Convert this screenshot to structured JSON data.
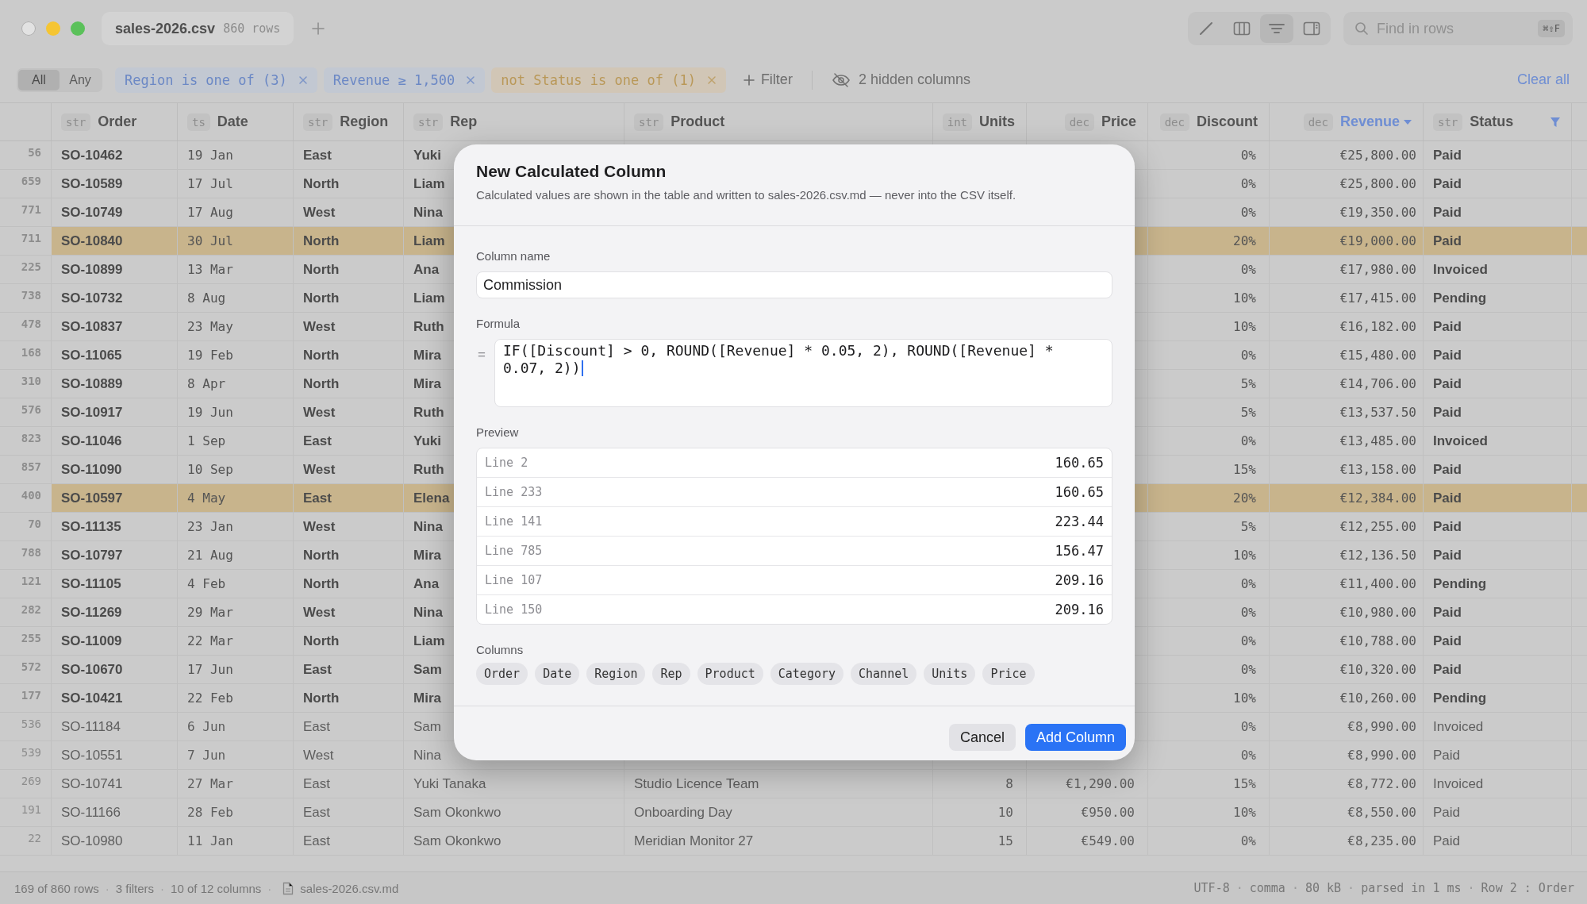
{
  "tab": {
    "title": "sales-2026.csv",
    "meta": "860 rows"
  },
  "toolbar": [
    {
      "kind": "pencil",
      "selected": false
    },
    {
      "kind": "columns",
      "selected": false
    },
    {
      "kind": "lines",
      "selected": true
    },
    {
      "kind": "sidebar",
      "selected": false
    }
  ],
  "search": {
    "placeholder": "Find in rows",
    "shortcut": "⌘⇧F"
  },
  "filter_bar": {
    "match": [
      {
        "label": "All",
        "selected": true
      },
      {
        "label": "Any",
        "selected": false
      }
    ],
    "filters": [
      {
        "label": "Region is one of (3)",
        "kind": "include"
      },
      {
        "label": "Revenue ≥ 1,500",
        "kind": "include"
      },
      {
        "label": "not Status is one of (1)",
        "kind": "exclude"
      }
    ],
    "add_filter": "Filter",
    "hidden_columns": "2 hidden columns",
    "clear": "Clear all"
  },
  "table": {
    "columns": [
      {
        "type": "str",
        "name": "Order",
        "sorted": false,
        "filtered": false
      },
      {
        "type": "ts",
        "name": "Date",
        "sorted": false,
        "filtered": false
      },
      {
        "type": "str",
        "name": "Region",
        "sorted": false,
        "filtered": false
      },
      {
        "type": "str",
        "name": "Rep",
        "sorted": false,
        "filtered": false
      },
      {
        "type": "str",
        "name": "Product",
        "sorted": false,
        "filtered": false
      },
      {
        "type": "int",
        "name": "Units",
        "sorted": false,
        "filtered": false
      },
      {
        "type": "dec",
        "name": "Price",
        "sorted": false,
        "filtered": false
      },
      {
        "type": "dec",
        "name": "Discount",
        "sorted": false,
        "filtered": false
      },
      {
        "type": "dec",
        "name": "Revenue",
        "sorted": true,
        "filtered": false
      },
      {
        "type": "str",
        "name": "Status",
        "sorted": false,
        "filtered": true
      }
    ],
    "rows": [
      {
        "line": "56",
        "order": "SO-10462",
        "date": "19 Jan",
        "region": "East",
        "rep": "Yuki",
        "discount": "0%",
        "revenue": "€25,800.00",
        "status": "Paid",
        "highlighted": false,
        "emphasized": true
      },
      {
        "line": "659",
        "order": "SO-10589",
        "date": "17 Jul",
        "region": "North",
        "rep": "Liam",
        "discount": "0%",
        "revenue": "€25,800.00",
        "status": "Paid",
        "highlighted": false,
        "emphasized": true
      },
      {
        "line": "771",
        "order": "SO-10749",
        "date": "17 Aug",
        "region": "West",
        "rep": "Nina",
        "discount": "0%",
        "revenue": "€19,350.00",
        "status": "Paid",
        "highlighted": false,
        "emphasized": true
      },
      {
        "line": "711",
        "order": "SO-10840",
        "date": "30 Jul",
        "region": "North",
        "rep": "Liam",
        "discount": "20%",
        "revenue": "€19,000.00",
        "status": "Paid",
        "highlighted": true,
        "emphasized": true
      },
      {
        "line": "225",
        "order": "SO-10899",
        "date": "13 Mar",
        "region": "North",
        "rep": "Ana",
        "discount": "0%",
        "revenue": "€17,980.00",
        "status": "Invoiced",
        "highlighted": false,
        "emphasized": true
      },
      {
        "line": "738",
        "order": "SO-10732",
        "date": "8 Aug",
        "region": "North",
        "rep": "Liam",
        "discount": "10%",
        "revenue": "€17,415.00",
        "status": "Pending",
        "highlighted": false,
        "emphasized": true
      },
      {
        "line": "478",
        "order": "SO-10837",
        "date": "23 May",
        "region": "West",
        "rep": "Ruth",
        "discount": "10%",
        "revenue": "€16,182.00",
        "status": "Paid",
        "highlighted": false,
        "emphasized": true
      },
      {
        "line": "168",
        "order": "SO-11065",
        "date": "19 Feb",
        "region": "North",
        "rep": "Mira",
        "discount": "0%",
        "revenue": "€15,480.00",
        "status": "Paid",
        "highlighted": false,
        "emphasized": true
      },
      {
        "line": "310",
        "order": "SO-10889",
        "date": "8 Apr",
        "region": "North",
        "rep": "Mira",
        "discount": "5%",
        "revenue": "€14,706.00",
        "status": "Paid",
        "highlighted": false,
        "emphasized": true
      },
      {
        "line": "576",
        "order": "SO-10917",
        "date": "19 Jun",
        "region": "West",
        "rep": "Ruth",
        "discount": "5%",
        "revenue": "€13,537.50",
        "status": "Paid",
        "highlighted": false,
        "emphasized": true
      },
      {
        "line": "823",
        "order": "SO-11046",
        "date": "1 Sep",
        "region": "East",
        "rep": "Yuki",
        "discount": "0%",
        "revenue": "€13,485.00",
        "status": "Invoiced",
        "highlighted": false,
        "emphasized": true
      },
      {
        "line": "857",
        "order": "SO-11090",
        "date": "10 Sep",
        "region": "West",
        "rep": "Ruth",
        "discount": "15%",
        "revenue": "€13,158.00",
        "status": "Paid",
        "highlighted": false,
        "emphasized": true
      },
      {
        "line": "400",
        "order": "SO-10597",
        "date": "4 May",
        "region": "East",
        "rep": "Elena",
        "discount": "20%",
        "revenue": "€12,384.00",
        "status": "Paid",
        "highlighted": true,
        "emphasized": true
      },
      {
        "line": "70",
        "order": "SO-11135",
        "date": "23 Jan",
        "region": "West",
        "rep": "Nina",
        "discount": "5%",
        "revenue": "€12,255.00",
        "status": "Paid",
        "highlighted": false,
        "emphasized": true
      },
      {
        "line": "788",
        "order": "SO-10797",
        "date": "21 Aug",
        "region": "North",
        "rep": "Mira",
        "discount": "10%",
        "revenue": "€12,136.50",
        "status": "Paid",
        "highlighted": false,
        "emphasized": true
      },
      {
        "line": "121",
        "order": "SO-11105",
        "date": "4 Feb",
        "region": "North",
        "rep": "Ana",
        "discount": "0%",
        "revenue": "€11,400.00",
        "status": "Pending",
        "highlighted": false,
        "emphasized": true
      },
      {
        "line": "282",
        "order": "SO-11269",
        "date": "29 Mar",
        "region": "West",
        "rep": "Nina",
        "discount": "0%",
        "revenue": "€10,980.00",
        "status": "Paid",
        "highlighted": false,
        "emphasized": true
      },
      {
        "line": "255",
        "order": "SO-11009",
        "date": "22 Mar",
        "region": "North",
        "rep": "Liam",
        "discount": "0%",
        "revenue": "€10,788.00",
        "status": "Paid",
        "highlighted": false,
        "emphasized": true
      },
      {
        "line": "572",
        "order": "SO-10670",
        "date": "17 Jun",
        "region": "East",
        "rep": "Sam",
        "discount": "0%",
        "revenue": "€10,320.00",
        "status": "Paid",
        "highlighted": false,
        "emphasized": true
      },
      {
        "line": "177",
        "order": "SO-10421",
        "date": "22 Feb",
        "region": "North",
        "rep": "Mira",
        "discount": "10%",
        "revenue": "€10,260.00",
        "status": "Pending",
        "highlighted": false,
        "emphasized": true
      },
      {
        "line": "536",
        "order": "SO-11184",
        "date": "6 Jun",
        "region": "East",
        "rep": "Sam",
        "discount": "0%",
        "revenue": "€8,990.00",
        "status": "Invoiced",
        "highlighted": false,
        "emphasized": false
      },
      {
        "line": "539",
        "order": "SO-10551",
        "date": "7 Jun",
        "region": "West",
        "rep": "Nina",
        "discount": "0%",
        "revenue": "€8,990.00",
        "status": "Paid",
        "highlighted": false,
        "emphasized": false
      },
      {
        "line": "269",
        "order": "SO-10741",
        "date": "27 Mar",
        "region": "East",
        "rep": "Yuki Tanaka",
        "product": "Studio Licence Team",
        "units": "8",
        "price": "€1,290.00",
        "discount": "15%",
        "revenue": "€8,772.00",
        "status": "Invoiced",
        "highlighted": false,
        "emphasized": false
      },
      {
        "line": "191",
        "order": "SO-11166",
        "date": "28 Feb",
        "region": "East",
        "rep": "Sam Okonkwo",
        "product": "Onboarding Day",
        "units": "10",
        "price": "€950.00",
        "discount": "10%",
        "revenue": "€8,550.00",
        "status": "Paid",
        "highlighted": false,
        "emphasized": false
      },
      {
        "line": "22",
        "order": "SO-10980",
        "date": "11 Jan",
        "region": "East",
        "rep": "Sam Okonkwo",
        "product": "Meridian Monitor 27",
        "units": "15",
        "price": "€549.00",
        "discount": "0%",
        "revenue": "€8,235.00",
        "status": "Paid",
        "highlighted": false,
        "emphasized": false
      }
    ]
  },
  "status_bar": {
    "separator": "·",
    "left": [
      "169 of 860 rows",
      "3 filters",
      "10 of 12 columns"
    ],
    "file": "sales-2026.csv.md",
    "right": [
      "UTF-8",
      "comma",
      "80 kB",
      "parsed in 1 ms",
      "Row 2 : Order"
    ]
  },
  "dialog": {
    "title": "New Calculated Column",
    "description": "Calculated values are shown in the table and written to sales-2026.csv.md — never into the CSV itself.",
    "name_label": "Column name",
    "name_value": "Commission",
    "formula_label": "Formula",
    "formula_prefix": "=",
    "formula": "IF([Discount] > 0, ROUND([Revenue] * 0.05, 2), ROUND([Revenue] * 0.07, 2))",
    "preview_label": "Preview",
    "preview": [
      {
        "line": "Line 2",
        "value": "160.65"
      },
      {
        "line": "Line 233",
        "value": "160.65"
      },
      {
        "line": "Line 141",
        "value": "223.44"
      },
      {
        "line": "Line 785",
        "value": "156.47"
      },
      {
        "line": "Line 107",
        "value": "209.16"
      },
      {
        "line": "Line 150",
        "value": "209.16"
      }
    ],
    "columns_label": "Columns",
    "columns": [
      "Order",
      "Date",
      "Region",
      "Rep",
      "Product",
      "Category",
      "Channel",
      "Units",
      "Price"
    ],
    "buttons": [
      {
        "label": "Cancel",
        "kind": "secondary"
      },
      {
        "label": "Add Column",
        "kind": "primary"
      }
    ]
  }
}
